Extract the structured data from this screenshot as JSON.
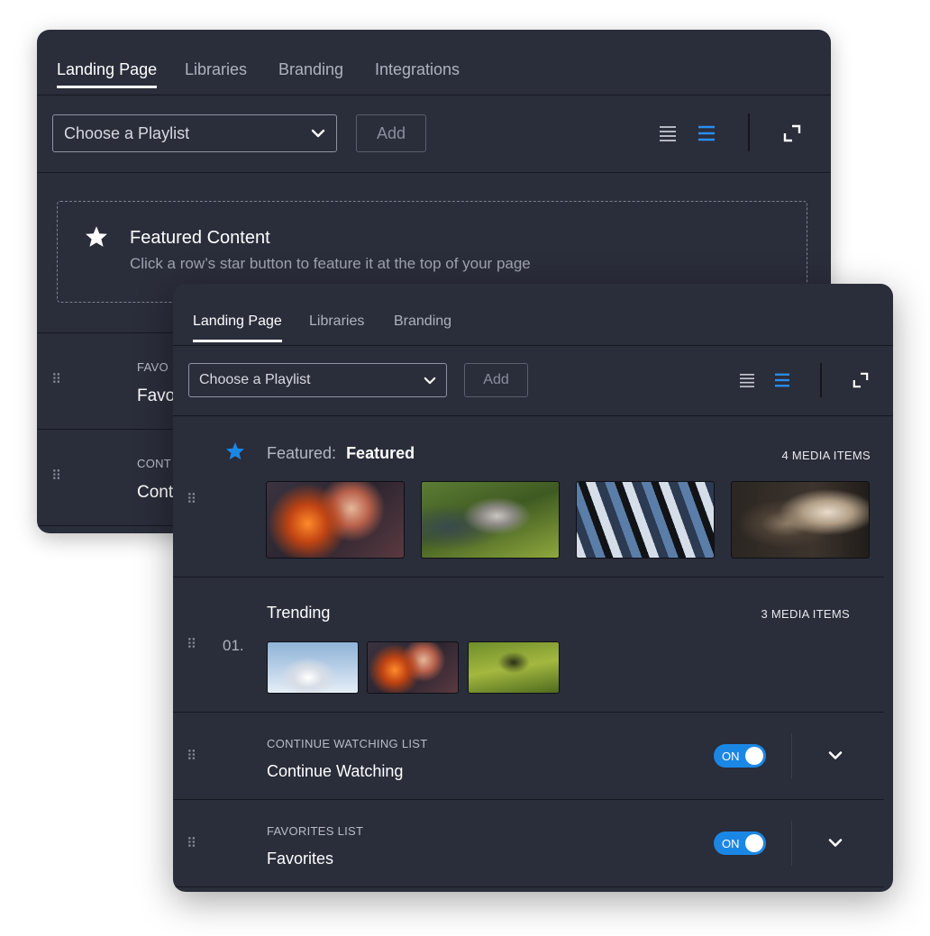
{
  "back_panel": {
    "tabs": [
      {
        "label": "Landing Page",
        "active": true
      },
      {
        "label": "Libraries",
        "active": false
      },
      {
        "label": "Branding",
        "active": false
      },
      {
        "label": "Integrations",
        "active": false
      }
    ],
    "toolbar": {
      "playlist_placeholder": "Choose a Playlist",
      "add_label": "Add"
    },
    "featured": {
      "title": "Featured Content",
      "subtitle": "Click a row’s star button to feature it at the top of your page"
    },
    "rows": [
      {
        "caption": "FAVO",
        "title": "Favo"
      },
      {
        "caption": "CONT",
        "title": "Cont"
      }
    ]
  },
  "front_panel": {
    "tabs": [
      {
        "label": "Landing Page",
        "active": true
      },
      {
        "label": "Libraries",
        "active": false
      },
      {
        "label": "Branding",
        "active": false
      }
    ],
    "toolbar": {
      "playlist_placeholder": "Choose a Playlist",
      "add_label": "Add"
    },
    "featured_row": {
      "prefix": "Featured:",
      "name": "Featured",
      "count": "4 MEDIA ITEMS"
    },
    "trending_row": {
      "index": "01.",
      "name": "Trending",
      "count": "3 MEDIA ITEMS"
    },
    "list_rows": [
      {
        "caption": "CONTINUE WATCHING LIST",
        "title": "Continue Watching",
        "toggle": "ON"
      },
      {
        "caption": "FAVORITES LIST",
        "title": "Favorites",
        "toggle": "ON"
      }
    ]
  },
  "colors": {
    "panel_bg": "#2a2d3a",
    "accent": "#1b87e4",
    "divider": "#171921"
  },
  "icons": [
    "star-icon",
    "chevron-down-icon",
    "list-view-icon",
    "compact-list-view-icon",
    "expand-icon",
    "drag-handle-icon"
  ]
}
